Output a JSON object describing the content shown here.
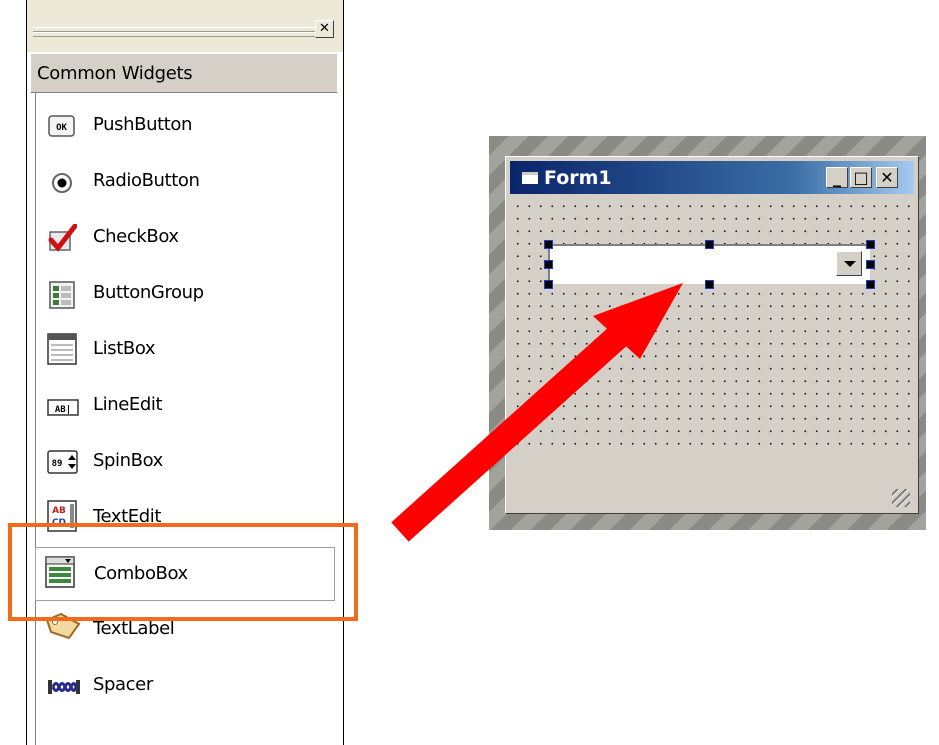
{
  "panel": {
    "close_symbol": "✕",
    "category": "Common Widgets",
    "items": [
      {
        "label": "PushButton",
        "icon": "pushbutton-icon"
      },
      {
        "label": "RadioButton",
        "icon": "radiobutton-icon"
      },
      {
        "label": "CheckBox",
        "icon": "checkbox-icon"
      },
      {
        "label": "ButtonGroup",
        "icon": "buttongroup-icon"
      },
      {
        "label": "ListBox",
        "icon": "listbox-icon"
      },
      {
        "label": "LineEdit",
        "icon": "lineedit-icon"
      },
      {
        "label": "SpinBox",
        "icon": "spinbox-icon"
      },
      {
        "label": "TextEdit",
        "icon": "textedit-icon"
      },
      {
        "label": "ComboBox",
        "icon": "combobox-icon"
      },
      {
        "label": "TextLabel",
        "icon": "textlabel-icon"
      },
      {
        "label": "Spacer",
        "icon": "spacer-icon"
      }
    ],
    "pushbutton_icon_text": "OK",
    "lineedit_icon_text": "AB|",
    "spinbox_icon_text": "89",
    "textedit_icon_text": "AB",
    "textedit_icon_text2": "CD"
  },
  "form": {
    "title": "Form1",
    "minimize_symbol": "_",
    "maximize_symbol": "□",
    "close_symbol": "✕"
  },
  "colors": {
    "highlight": "#f26b1d",
    "arrow": "#ff0000",
    "titlebar_start": "#0a246a",
    "titlebar_end": "#a6caf0"
  }
}
